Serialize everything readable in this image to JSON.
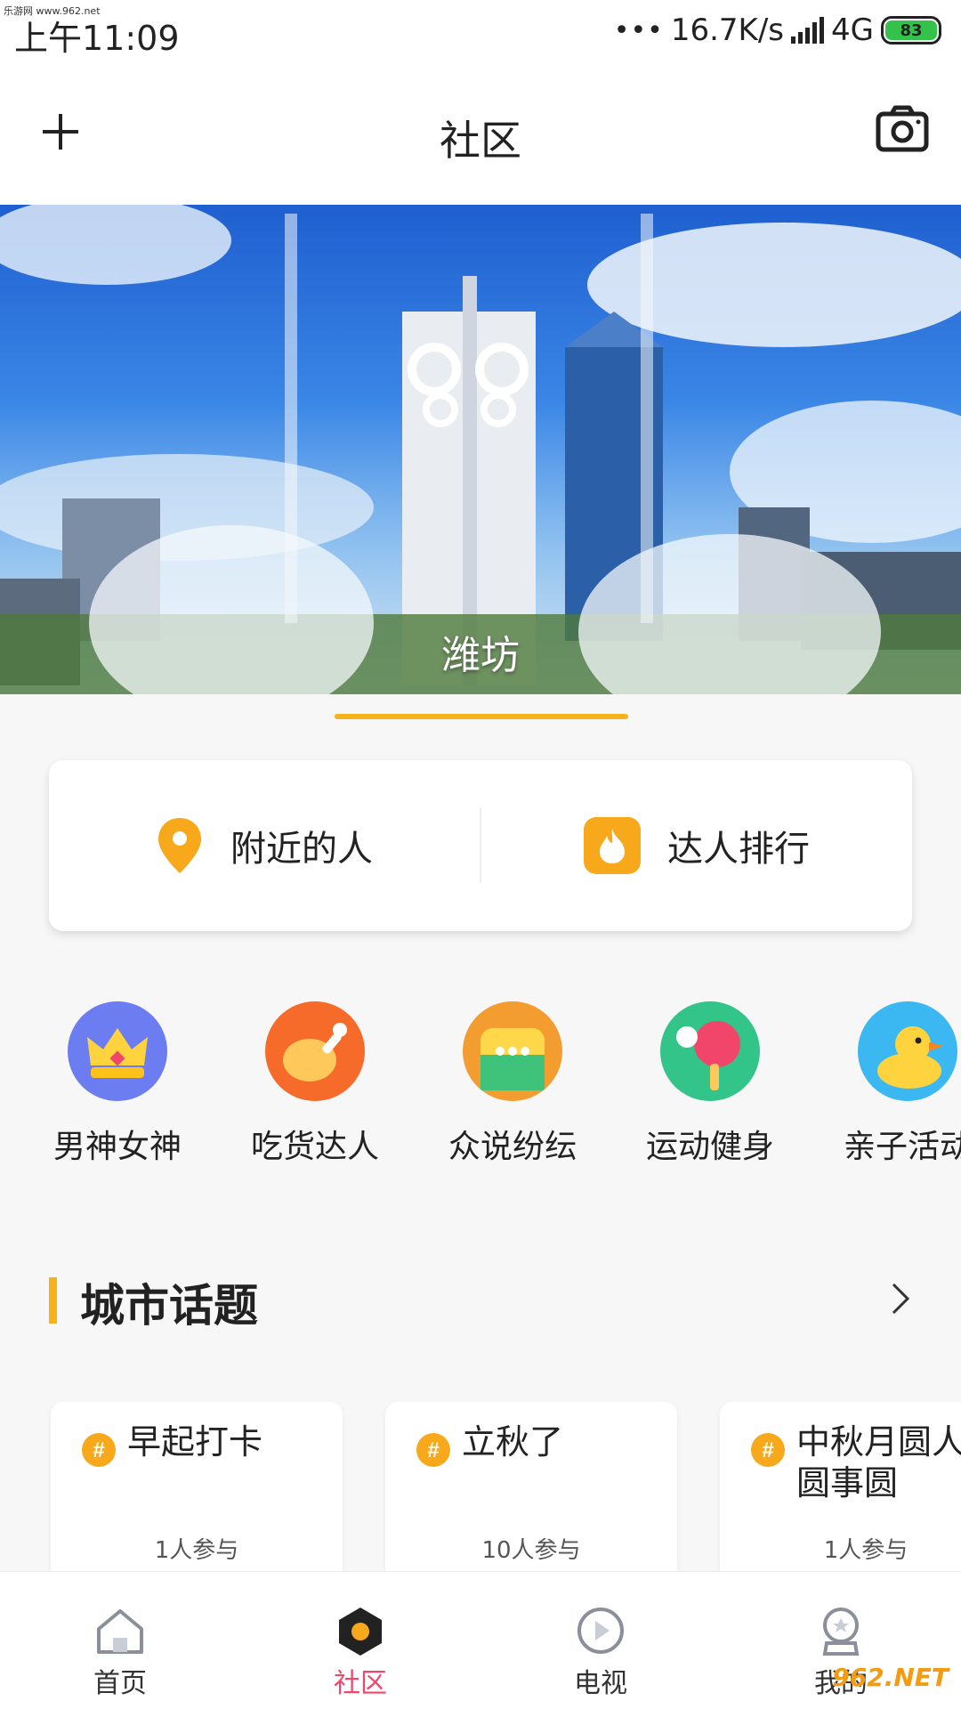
{
  "status_bar": {
    "watermark": "乐游网 www.962.net",
    "time": "上午11:09",
    "speed": "16.7K/s",
    "network": "4G",
    "battery": "83"
  },
  "header": {
    "title": "社区",
    "left_icon": "plus-icon",
    "right_icon": "camera-icon"
  },
  "banner": {
    "caption": "潍坊"
  },
  "quick_actions": [
    {
      "label": "附近的人",
      "icon": "location-pin-icon"
    },
    {
      "label": "达人排行",
      "icon": "flame-icon"
    }
  ],
  "categories": [
    {
      "label": "男神女神",
      "icon": "crown-icon",
      "color": "#6c7df2"
    },
    {
      "label": "吃货达人",
      "icon": "chicken-leg-icon",
      "color": "#f76b2a"
    },
    {
      "label": "众说纷纭",
      "icon": "chat-bubble-icon",
      "color": "#f39c2f"
    },
    {
      "label": "运动健身",
      "icon": "ping-pong-icon",
      "color": "#33c48a"
    },
    {
      "label": "亲子活动",
      "icon": "duck-icon",
      "color": "#3bb8f2"
    }
  ],
  "section": {
    "title": "城市话题"
  },
  "topics": [
    {
      "title": "早起打卡",
      "count": "1人参与"
    },
    {
      "title": "立秋了",
      "count": "10人参与"
    },
    {
      "title_line1": "中秋月圆人",
      "title_line2": "圆事圆",
      "count": "1人参与"
    }
  ],
  "bottom_nav": [
    {
      "label": "首页",
      "icon": "home-icon",
      "active": false
    },
    {
      "label": "社区",
      "icon": "community-icon",
      "active": true
    },
    {
      "label": "电视",
      "icon": "tv-play-icon",
      "active": false
    },
    {
      "label": "我的",
      "icon": "profile-icon",
      "active": false
    }
  ],
  "colors": {
    "accent": "#f5b21b",
    "active_tab": "#f1466a"
  },
  "bottom_watermark": "962.NET"
}
